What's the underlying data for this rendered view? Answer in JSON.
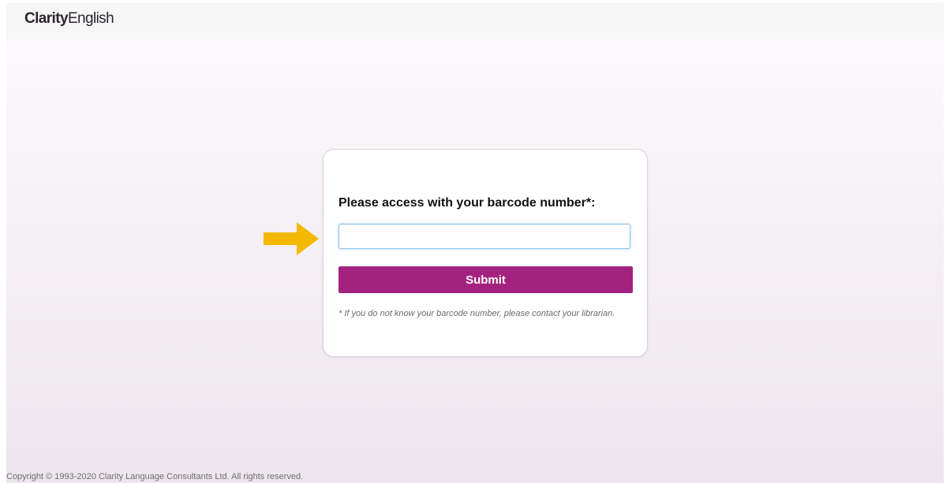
{
  "header": {
    "logo_bold": "Clarity",
    "logo_light": "English"
  },
  "login": {
    "prompt": "Please access with your barcode number*:",
    "barcode_value": "",
    "submit_label": "Submit",
    "note": "* If you do not know your barcode number, please contact your librarian."
  },
  "annotation": {
    "arrow_icon": "arrow-right-icon",
    "arrow_color": "#f5b800"
  },
  "footer": {
    "copyright": "Copyright © 1993-2020 Clarity Language Consultants Ltd. All rights reserved."
  },
  "colors": {
    "accent": "#a4227f",
    "input_focus_border": "#8cc4e8"
  }
}
